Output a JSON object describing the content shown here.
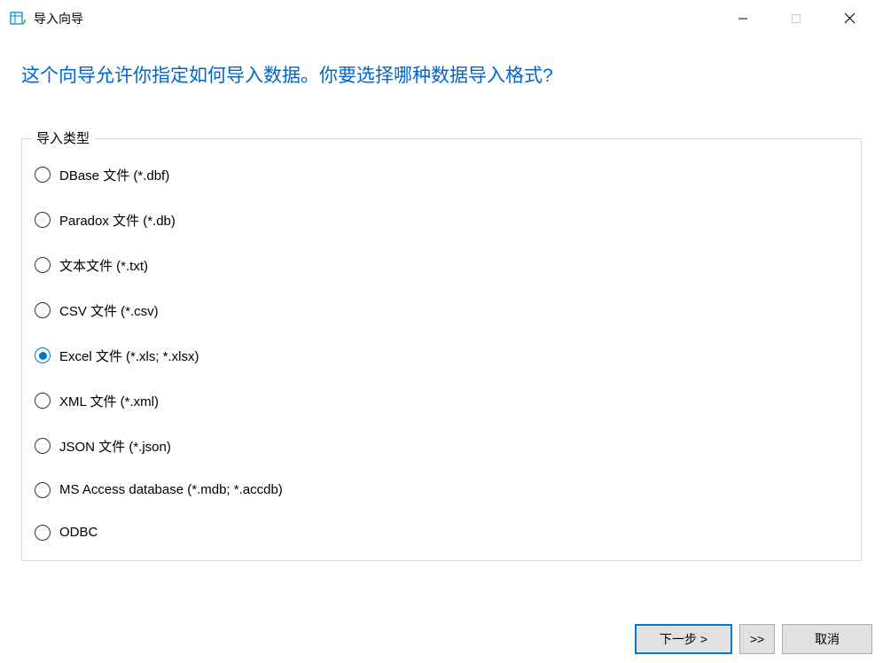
{
  "titlebar": {
    "title": "导入向导"
  },
  "heading": "这个向导允许你指定如何导入数据。你要选择哪种数据导入格式?",
  "fieldset": {
    "legend": "导入类型",
    "options": [
      {
        "label": "DBase 文件 (*.dbf)",
        "selected": false
      },
      {
        "label": "Paradox 文件 (*.db)",
        "selected": false
      },
      {
        "label": "文本文件 (*.txt)",
        "selected": false
      },
      {
        "label": "CSV 文件 (*.csv)",
        "selected": false
      },
      {
        "label": "Excel 文件 (*.xls; *.xlsx)",
        "selected": true
      },
      {
        "label": "XML 文件 (*.xml)",
        "selected": false
      },
      {
        "label": "JSON 文件 (*.json)",
        "selected": false
      },
      {
        "label": "MS Access database (*.mdb; *.accdb)",
        "selected": false
      },
      {
        "label": "ODBC",
        "selected": false
      }
    ]
  },
  "footer": {
    "next": "下一步 >",
    "skip": ">>",
    "cancel": "取消"
  }
}
